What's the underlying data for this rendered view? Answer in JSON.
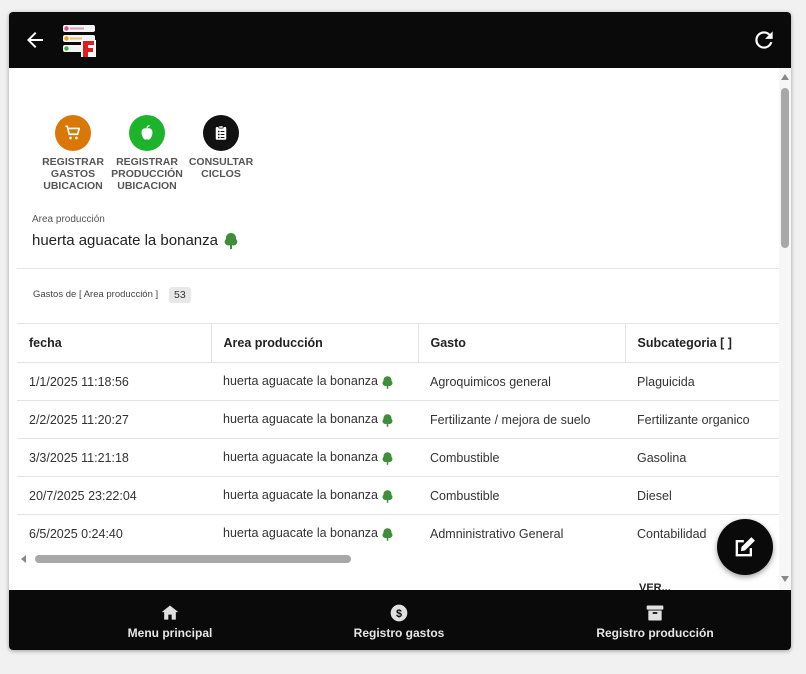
{
  "actions": [
    {
      "label": "REGISTRAR GASTOS UBICACION",
      "color": "#d97708",
      "icon": "cart-icon"
    },
    {
      "label": "REGISTRAR PRODUCCIÓN UBICACION",
      "color": "#1db32a",
      "icon": "apple-icon"
    },
    {
      "label": "CONSULTAR CICLOS",
      "color": "#111111",
      "icon": "clipboard-icon"
    }
  ],
  "area": {
    "label": "Area producción",
    "value": "huerta aguacate la bonanza",
    "icon": "tree-icon"
  },
  "gastos": {
    "label": "Gastos de [ Area producción ]",
    "count": "53"
  },
  "table": {
    "headers": [
      "fecha",
      "Area producción",
      "Gasto",
      "Subcategoria [ ]"
    ],
    "rows": [
      [
        "1/1/2025 11:18:56",
        "huerta aguacate la bonanza",
        "Agroquimicos general",
        "Plaguicida"
      ],
      [
        "2/2/2025 11:20:27",
        "huerta aguacate la bonanza",
        "Fertilizante / mejora de suelo",
        "Fertilizante organico"
      ],
      [
        "3/3/2025 11:21:18",
        "huerta aguacate la bonanza",
        "Combustible",
        "Gasolina"
      ],
      [
        "20/7/2025 23:22:04",
        "huerta aguacate la bonanza",
        "Combustible",
        "Diesel"
      ],
      [
        "6/5/2025 0:24:40",
        "huerta aguacate la bonanza",
        "Admninistrativo General",
        "Contabilidad"
      ]
    ]
  },
  "partial_text": "VER...",
  "nav": [
    {
      "label": "Menu principal",
      "icon": "home-icon"
    },
    {
      "label": "Registro gastos",
      "icon": "dollar-icon"
    },
    {
      "label": "Registro producción",
      "icon": "archive-icon"
    }
  ],
  "colors": {
    "bar": "#0a0a0a",
    "tree": "#3f8e3a"
  }
}
